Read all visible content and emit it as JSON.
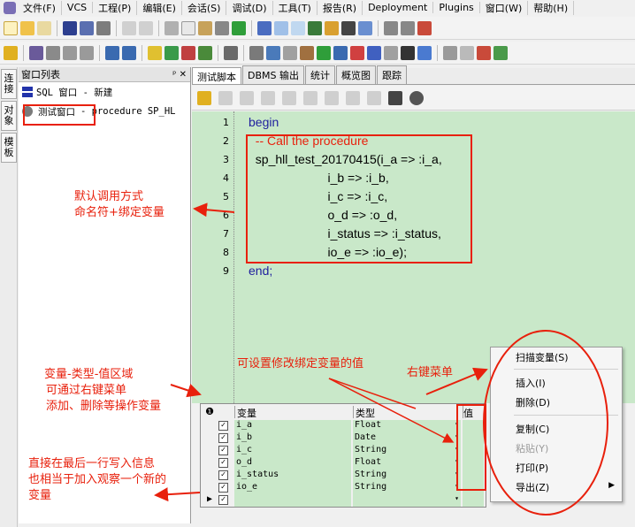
{
  "menubar": {
    "items": [
      "文件(F)",
      "VCS",
      "工程(P)",
      "编辑(E)",
      "会话(S)",
      "调试(D)",
      "工具(T)",
      "报告(R)",
      "Deployment",
      "Plugins",
      "窗口(W)",
      "帮助(H)"
    ]
  },
  "left_tabs": [
    "连接",
    "对象",
    "模板"
  ],
  "window_list": {
    "title": "窗口列表",
    "pin": "ᵖ ✕",
    "items": [
      {
        "label": "SQL 窗口 - 新建"
      },
      {
        "label": "测试窗口",
        "detail": "- procedure SP_HL"
      }
    ]
  },
  "tabs": [
    "测试脚本",
    "DBMS 输出",
    "统计",
    "概览图",
    "跟踪"
  ],
  "editor": {
    "line_numbers": [
      "1",
      "2",
      "3",
      "4",
      "5",
      "6",
      "7",
      "8",
      "9"
    ],
    "lines": [
      "begin",
      "  -- Call the procedure",
      "  sp_hll_test_20170415(i_a => :i_a,",
      "                       i_b => :i_b,",
      "                       i_c => :i_c,",
      "                       o_d => :o_d,",
      "                       i_status => :i_status,",
      "                       io_e => :io_e);",
      "end;"
    ]
  },
  "variables": {
    "headers": [
      "变量",
      "类型",
      "值"
    ],
    "rows": [
      {
        "name": "i_a",
        "type": "Float"
      },
      {
        "name": "i_b",
        "type": "Date"
      },
      {
        "name": "i_c",
        "type": "String"
      },
      {
        "name": "o_d",
        "type": "Float"
      },
      {
        "name": "i_status",
        "type": "String"
      },
      {
        "name": "io_e",
        "type": "String"
      }
    ]
  },
  "context_menu": {
    "items": [
      "扫描变量(S)",
      "插入(I)",
      "删除(D)",
      "复制(C)",
      "粘贴(Y)",
      "打印(P)",
      "导出(Z)"
    ]
  },
  "annotations": {
    "default_call_1": "默认调用方式",
    "default_call_2": "命名符+绑定变量",
    "settable": "可设置修改绑定变量的值",
    "right_menu": "右键菜单",
    "vars_1": "变量-类型-值区域",
    "vars_2": "可通过右键菜单",
    "vars_3": "添加、删除等操作变量",
    "last_1": "直接在最后一行写入信息",
    "last_2": "也相当于加入观察一个新的",
    "last_3": "变量"
  },
  "colors": {
    "editor_bg": "#c9e8c9",
    "keyword": "#1f1f9e",
    "comment": "#e8200c",
    "annotation": "#e8200c"
  }
}
